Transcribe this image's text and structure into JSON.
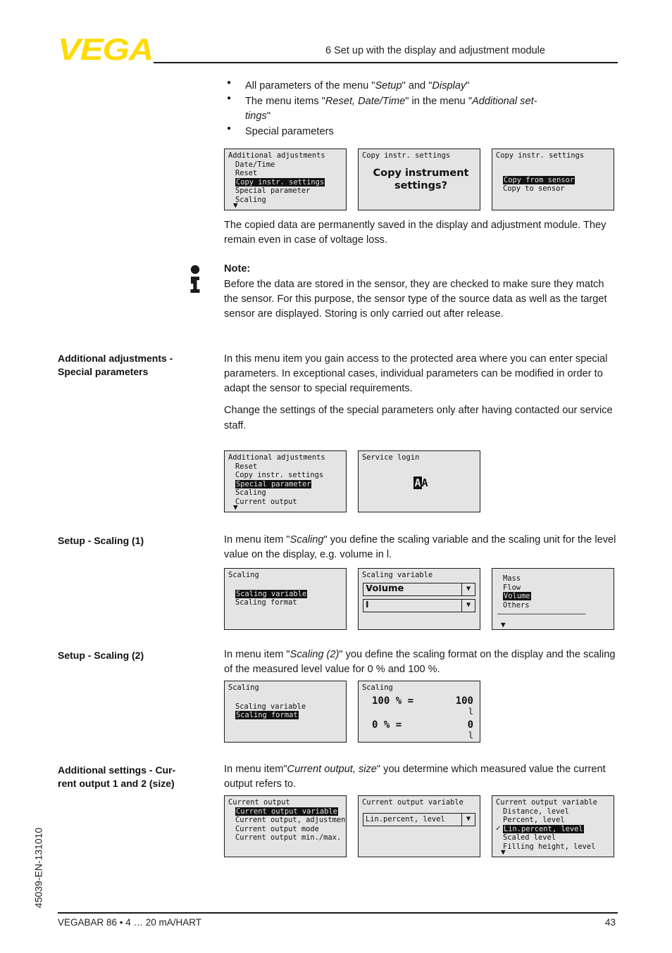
{
  "header": {
    "logo": "VEGA",
    "title": "6 Set up with the display and adjustment module"
  },
  "footer": {
    "left": "VEGABAR 86 • 4 … 20 mA/HART",
    "page": "43",
    "side_code": "45039-EN-131010"
  },
  "intro_bullets": [
    "All parameters of the menu \"Setup\" and \"Display\"",
    "The menu items \"Reset, Date/Time\" in the menu \"Additional settings\"",
    "Special parameters"
  ],
  "paragraphs": {
    "copied_data": "The copied data are permanently saved in the display and adjustment module. They remain even in case of voltage loss.",
    "note_title": "Note:",
    "note_body": "Before the data are stored in the sensor, they are checked to make sure they match the sensor. For this purpose, the sensor type of the source data as well as the target sensor are displayed. Storing is only carried out after release.",
    "special_1": "In this menu item you gain access to the protected area where you can enter special parameters. In exceptional cases, individual parameters can be modified in order to adapt the sensor to special requirements.",
    "special_2": "Change the settings of the special parameters only after having contacted our service staff.",
    "scaling1": "In menu item \"Scaling\" you define the scaling variable and the scaling unit for the level value on the display, e.g. volume in l.",
    "scaling2": "In menu item \"Scaling (2)\" you define the scaling format on the display and the scaling of the measured level value for 0 % and 100 %.",
    "current_output": "In menu item\"Current output, size\" you determine which measured value the current output refers to."
  },
  "margin_headings": {
    "special_parameters": "Additional adjustments - Special parameters",
    "scaling1": "Setup - Scaling (1)",
    "scaling2": "Setup - Scaling (2)",
    "current_output": "Additional settings - Current output 1 and 2 (size)"
  },
  "screens": {
    "s1": {
      "title": "Additional adjustments",
      "items": [
        "Date/Time",
        "Reset",
        "Copy instr. settings",
        "Special parameter",
        "Scaling"
      ],
      "selected": "Copy instr. settings",
      "scroll_arrow": "▼"
    },
    "s2": {
      "title": "Copy instr. settings",
      "line1": "Copy instrument",
      "line2": "settings?"
    },
    "s3": {
      "title": "Copy instr. settings",
      "items": [
        "Copy from sensor",
        "Copy to sensor"
      ],
      "selected": "Copy from sensor"
    },
    "s4": {
      "title": "Additional adjustments",
      "items": [
        "Reset",
        "Copy instr. settings",
        "Special parameter",
        "Scaling",
        "Current output"
      ],
      "selected": "Special parameter",
      "scroll_arrow": "▼"
    },
    "s5": {
      "title": "Service login",
      "code_hl": "A",
      "code_rest": "A"
    },
    "s6": {
      "title": "Scaling",
      "items": [
        "Scaling variable",
        "Scaling format"
      ],
      "selected": "Scaling variable"
    },
    "s7": {
      "title": "Scaling variable",
      "value1": "Volume",
      "value2": "l",
      "caret": "▼"
    },
    "s8": {
      "items": [
        "Mass",
        "Flow",
        "Volume",
        "Others"
      ],
      "selected": "Volume",
      "separator": "––––––––––––––––––––",
      "scroll_arrow": "▼"
    },
    "s9": {
      "title": "Scaling",
      "items": [
        "Scaling variable",
        "Scaling format"
      ],
      "selected": "Scaling format"
    },
    "s10": {
      "title": "Scaling",
      "row1_label": "100 % =",
      "row1_value": "100",
      "row1_unit": "l",
      "row2_label": "0 % =",
      "row2_value": "0",
      "row2_unit": "l"
    },
    "s11": {
      "title": "Current output",
      "items": [
        "Current output variable",
        "Current output, adjustment",
        "Current output mode",
        "Current output min./max."
      ],
      "selected": "Current output variable"
    },
    "s12": {
      "title": "Current output variable",
      "value": "Lin.percent, level",
      "caret": "▼"
    },
    "s13": {
      "title": "Current output variable",
      "items": [
        "Distance, level",
        "Percent, level",
        "Lin.percent, level",
        "Scaled level",
        "Filling height, level"
      ],
      "selected": "Lin.percent, level",
      "checked": "Lin.percent, level",
      "tick": "✓",
      "scroll_arrow": "▼"
    }
  },
  "colors": {
    "brand_yellow": "#FFDB00",
    "lcd_bg": "#e4e4e4",
    "ink": "#1a1a1a"
  }
}
